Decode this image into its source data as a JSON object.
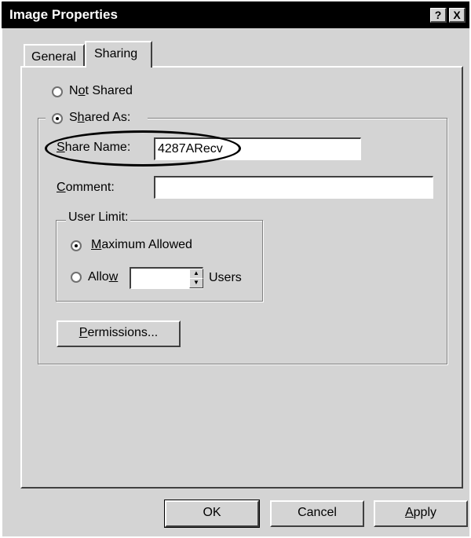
{
  "window": {
    "title": "Image Properties",
    "help_button": "?",
    "close_button": "X"
  },
  "tabs": [
    {
      "label": "General",
      "active": false
    },
    {
      "label": "Sharing",
      "active": true
    }
  ],
  "sharing": {
    "not_shared_label": "Not Shared",
    "shared_as_label": "Shared As:",
    "share_name_label": "Share Name:",
    "share_name_value": "4287ARecv",
    "comment_label": "Comment:",
    "comment_value": "",
    "user_limit_group": "User Limit:",
    "maximum_allowed_label": "Maximum Allowed",
    "allow_label": "Allow",
    "allow_value": "",
    "users_label": "Users",
    "permissions_button": "Permissions...",
    "selected_share_mode": "Shared As",
    "selected_user_limit": "Maximum Allowed"
  },
  "footer": {
    "ok": "OK",
    "cancel": "Cancel",
    "apply": "Apply"
  }
}
